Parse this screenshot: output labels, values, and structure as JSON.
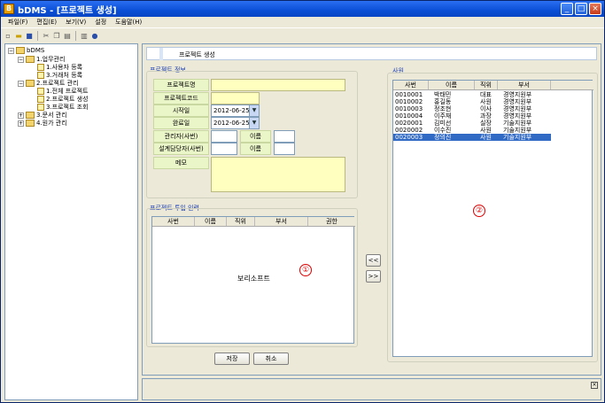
{
  "window": {
    "title": "bDMS - [프로젝트 생성]",
    "icon_text": "B"
  },
  "menu": [
    "파일(F)",
    "편집(E)",
    "보기(V)",
    "설정",
    "도움말(H)"
  ],
  "tree": {
    "root": "bDMS",
    "items": [
      {
        "label": "1.업무관리"
      },
      {
        "label": "1.사용자 등록"
      },
      {
        "label": "3.거래처 등록"
      },
      {
        "label": "2.프로젝트 관리"
      },
      {
        "label": "1.전체 프로젝트"
      },
      {
        "label": "2.프로젝트 생성"
      },
      {
        "label": "3.프로젝트 조회"
      },
      {
        "label": "3.문서 관리"
      },
      {
        "label": "4.원가 관리"
      }
    ]
  },
  "panel_title": "프로젝트 생성",
  "project_info": {
    "title": "프로젝트 정보",
    "name_label": "프로젝트명",
    "code_label": "프로젝트코드",
    "start_label": "시작일",
    "start_value": "2012-06-25",
    "end_label": "완료일",
    "end_value": "2012-06-25",
    "manager_label": "관리자(사번)",
    "designer_label": "설계담당자(사번)",
    "name_sub_label": "이름",
    "name_sub_label2": "이름",
    "memo_label": "메모"
  },
  "assign": {
    "title": "프로젝트 투입 인력",
    "columns": [
      "사번",
      "이름",
      "직위",
      "부서",
      "권한"
    ],
    "watermark": "보리소프트",
    "marker": "①"
  },
  "transfer": {
    "add_label": "<<",
    "remove_label": ">>"
  },
  "actions": {
    "save_label": "저장",
    "cancel_label": "취소"
  },
  "staff": {
    "title": "사원",
    "columns": [
      "사번",
      "이름",
      "직위",
      "부서"
    ],
    "marker": "②",
    "rows": [
      [
        "0010001",
        "박태민",
        "대표",
        "경영지원부"
      ],
      [
        "0010002",
        "홍길동",
        "사원",
        "경영지원부"
      ],
      [
        "0010003",
        "정조현",
        "이사",
        "경영지원부"
      ],
      [
        "0010004",
        "이주재",
        "과장",
        "경영지원부"
      ],
      [
        "0020001",
        "김미선",
        "실장",
        "기술지원부"
      ],
      [
        "0020002",
        "이수진",
        "사원",
        "기술지원부"
      ],
      [
        "0020003",
        "정의진",
        "사원",
        "기술지원부"
      ]
    ],
    "selected_index": 6
  },
  "icons": {
    "minimize": "minimize-icon",
    "maximize": "maximize-icon",
    "close": "close-icon"
  }
}
